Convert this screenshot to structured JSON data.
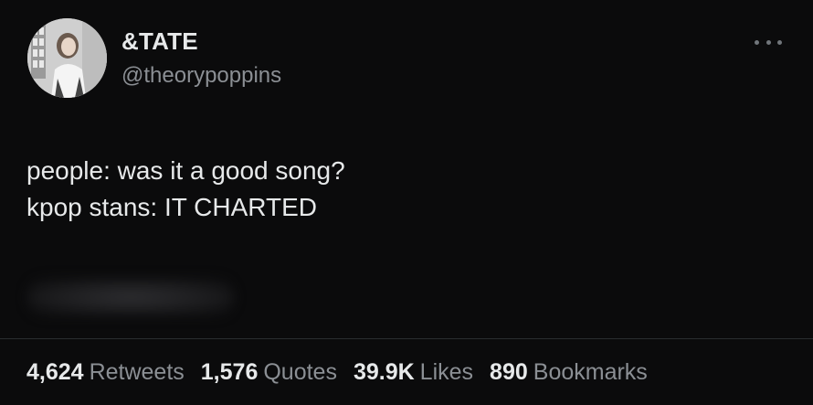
{
  "author": {
    "display_name": "&TATE",
    "handle": "@theorypoppins",
    "avatar_icon": "profile-photo"
  },
  "tweet": {
    "lines": [
      "people: was it a good song?",
      "kpop stans: IT CHARTED"
    ]
  },
  "stats": [
    {
      "value": "4,624",
      "label": "Retweets"
    },
    {
      "value": "1,576",
      "label": "Quotes"
    },
    {
      "value": "39.9K",
      "label": "Likes"
    },
    {
      "value": "890",
      "label": "Bookmarks"
    }
  ],
  "colors": {
    "background": "#0b0b0c",
    "text_primary": "#e7e9ea",
    "text_secondary": "#8b8f94",
    "divider": "#2a2d30"
  },
  "icons": {
    "more": "more-horizontal-icon"
  }
}
